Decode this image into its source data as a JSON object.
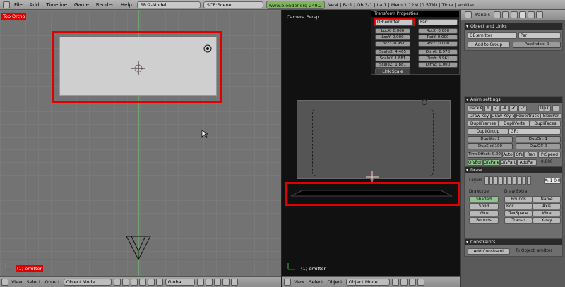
{
  "menubar": {
    "items": [
      "File",
      "Add",
      "Timeline",
      "Game",
      "Render",
      "Help"
    ],
    "screen_field": "SR:2-Model",
    "scene_field": "SCE:Scene",
    "url": "www.blender.org 249.2",
    "stats": "Ve:4 | Fa:1 | Ob:3-1 | La:1 | Mem:1.12M (0.57M) | Time | emitter"
  },
  "left_view": {
    "label": "Top Ortho",
    "object_label": "(1) emitter",
    "header": {
      "menus": [
        "View",
        "Select",
        "Object"
      ],
      "mode": "Object Mode",
      "orientation": "Global"
    }
  },
  "mid_view": {
    "label": "Camera Persp",
    "object_label": "(1) emitter",
    "header": {
      "menus": [
        "View",
        "Select",
        "Object"
      ],
      "mode": "Object Mode"
    }
  },
  "transform": {
    "title": "Transform Properties",
    "name": "OB:emitter",
    "parent": "Par:",
    "loc": [
      "LocX: 0.000",
      "LocY: 0.000",
      "LocZ: -0.951"
    ],
    "rot": [
      "RotX: 0.000",
      "RotY: 0.000",
      "RotZ: 0.000"
    ],
    "scale": [
      "ScaleX: 4.465",
      "ScaleY: 1.881",
      "ScaleZ: 1.881"
    ],
    "dim": [
      "DimX: 8.970",
      "DimY: 3.961",
      "DimZ: 0.000"
    ],
    "link_scale": "Link Scale"
  },
  "panels": {
    "header_title": "Panels",
    "object_links": {
      "title": "Object and Links",
      "ob_name": "OB:emitter",
      "par": "Par",
      "add_group": "Add to Group",
      "pass_index": "PassIndex: 0"
    },
    "anim": {
      "title": "Anim settings",
      "track": "TrackX",
      "axes": [
        "Y",
        "Z",
        "-X",
        "-Y",
        "-Z"
      ],
      "upx": "UpX",
      "row2": [
        "Draw Key",
        "Draw Key S",
        "Powertrack",
        "SlowPar"
      ],
      "row3": [
        "DupliFrames",
        "DupliVerts",
        "DupliFaces"
      ],
      "dupli_group": "DupliGroup",
      "gr": "GR:",
      "dup_sta": "DupSta: 1",
      "dup_on": "DupOn: 1",
      "dup_end": "DupEnd 100",
      "dup_off": "DupOff 0",
      "row6": [
        "TimeOffset: 0.00",
        "Auto",
        "Ofs",
        "Ran",
        "PrSpeed"
      ],
      "row7": [
        "OfsEdit",
        "OfsParent",
        "OfsParti",
        "AddPar"
      ],
      "row7_value": "0.000"
    },
    "draw": {
      "title": "Draw",
      "layers": "Layers",
      "pass": "A: 1  0.0",
      "drawtype_label": "Drawtype",
      "drawtype": [
        "Shaded",
        "Solid",
        "Wire",
        "Bounds"
      ],
      "extra_label": "Draw Extra",
      "extra_left": [
        "Bounds",
        "Box",
        "TexSpace",
        "Transp"
      ],
      "extra_right": [
        "Name",
        "Axis",
        "Wire",
        "X-ray"
      ]
    },
    "constraints": {
      "title": "Constraints",
      "add": "Add Constraint",
      "to_object": "To Object: emitter"
    }
  },
  "colors": {
    "highlight": "#e00000",
    "url_green": "#7fb85a",
    "active_green": "#8fc48f"
  }
}
